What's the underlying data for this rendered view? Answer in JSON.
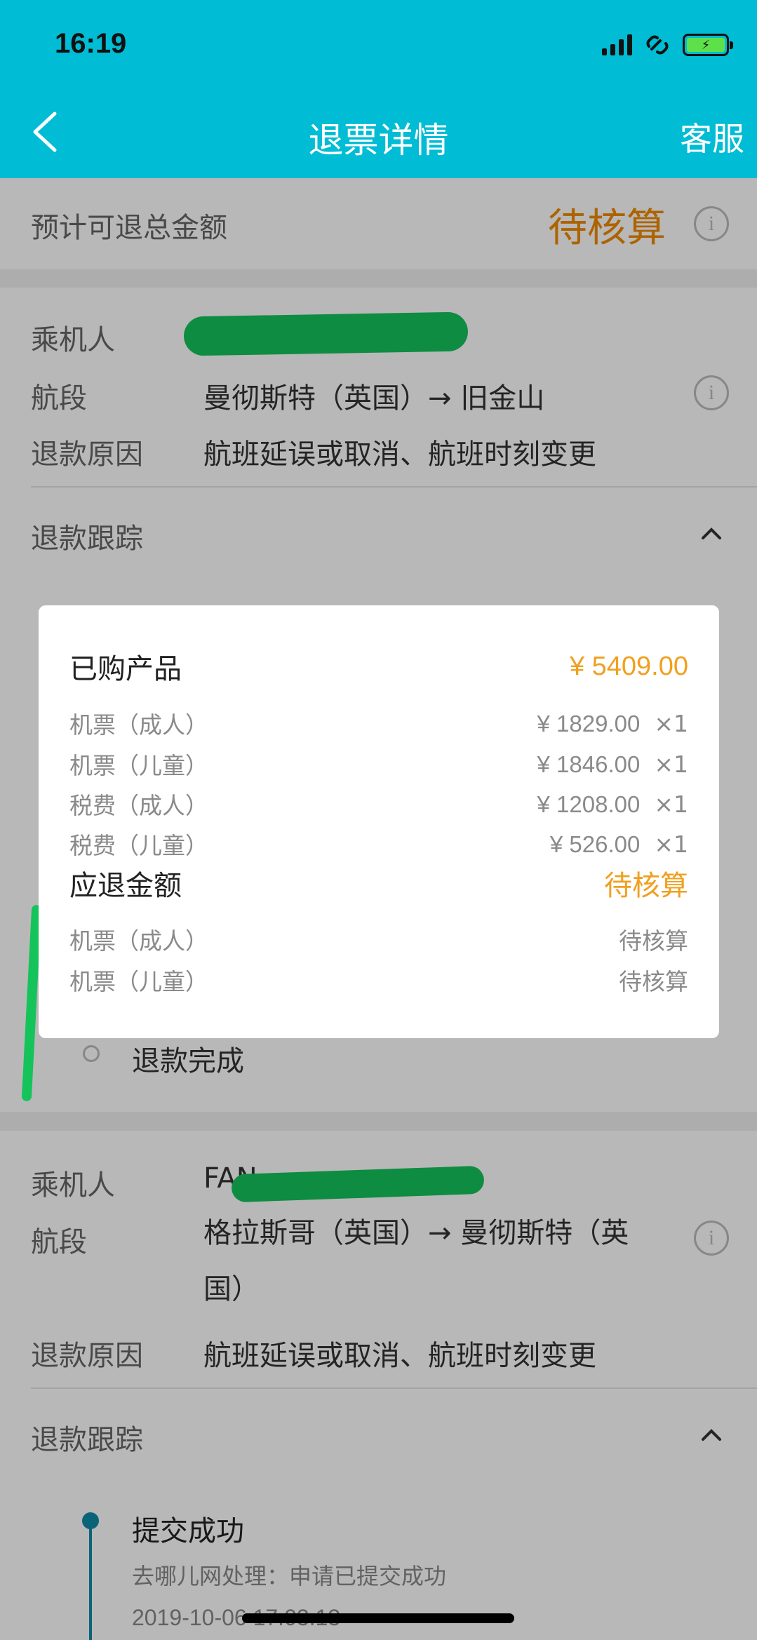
{
  "status_bar": {
    "time": "16:19"
  },
  "nav": {
    "title": "退票详情",
    "service": "客服"
  },
  "summary": {
    "label": "预计可退总金额",
    "value": "待核算"
  },
  "passenger1": {
    "passenger_label": "乘机人",
    "segment_label": "航段",
    "segment_value": "曼彻斯特（英国）→ 旧金山",
    "reason_label": "退款原因",
    "reason_value": "航班延误或取消、航班时刻变更",
    "tracking_label": "退款跟踪",
    "complete_text": "退款完成"
  },
  "passenger2": {
    "passenger_label": "乘机人",
    "passenger_value": "FAN",
    "segment_label": "航段",
    "segment_value": "格拉斯哥（英国）→ 曼彻斯特（英国）",
    "reason_label": "退款原因",
    "reason_value": "航班延误或取消、航班时刻变更",
    "tracking_label": "退款跟踪",
    "step_title": "提交成功",
    "step_desc": "去哪儿网处理：申请已提交成功",
    "step_time": "2019-10-06 17:03:13"
  },
  "modal": {
    "purchased_label": "已购产品",
    "purchased_total": "¥ 5409.00",
    "items": [
      {
        "name": "机票（成人）",
        "amount": "¥ 1829.00",
        "qty": "×1"
      },
      {
        "name": "机票（儿童）",
        "amount": "¥ 1846.00",
        "qty": "×1"
      },
      {
        "name": "税费（成人）",
        "amount": "¥ 1208.00",
        "qty": "×1"
      },
      {
        "name": "税费（儿童）",
        "amount": "¥ 526.00",
        "qty": "×1"
      }
    ],
    "refund_label": "应退金额",
    "refund_total": "待核算",
    "refund_items": [
      {
        "name": "机票（成人）",
        "value": "待核算"
      },
      {
        "name": "机票（儿童）",
        "value": "待核算"
      }
    ]
  },
  "colors": {
    "header": "#00bcd4",
    "accent_orange": "#f0a020",
    "redaction_green": "#14c35a"
  }
}
